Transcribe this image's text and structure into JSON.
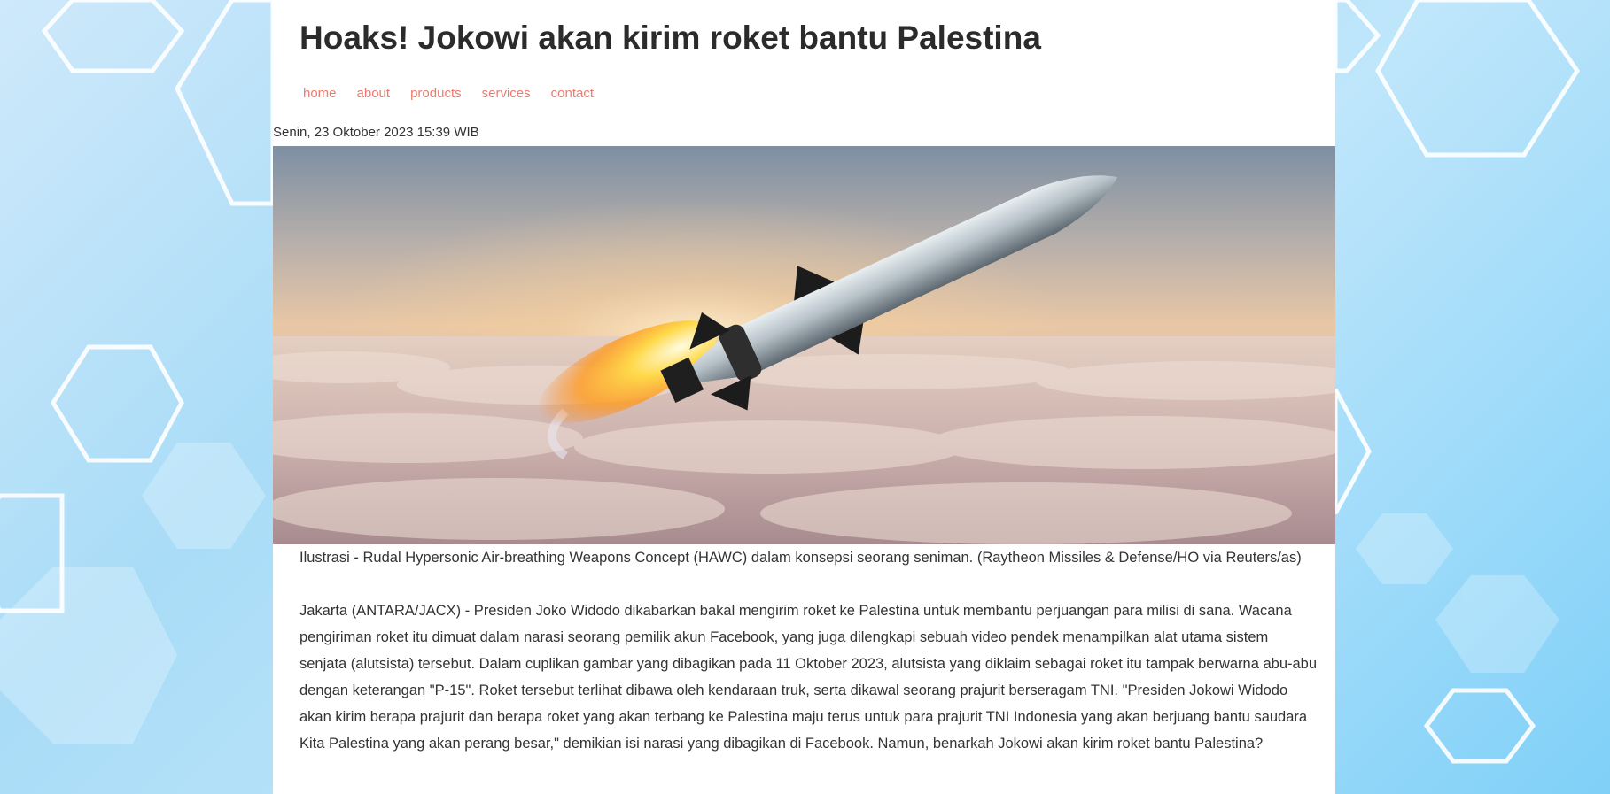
{
  "article": {
    "title": "Hoaks! Jokowi akan kirim roket bantu Palestina",
    "date": "Senin, 23 Oktober 2023 15:39 WIB",
    "image_caption": "Ilustrasi - Rudal Hypersonic Air-breathing Weapons Concept (HAWC) dalam konsepsi seorang seniman. (Raytheon Missiles & Defense/HO via Reuters/as)",
    "body": "Jakarta (ANTARA/JACX) - Presiden Joko Widodo dikabarkan bakal mengirim roket ke Palestina untuk membantu perjuangan para milisi di sana. Wacana pengiriman roket itu dimuat dalam narasi seorang pemilik akun Facebook, yang juga dilengkapi sebuah video pendek menampilkan alat utama sistem senjata (alutsista) tersebut. Dalam cuplikan gambar yang dibagikan pada 11 Oktober 2023, alutsista yang diklaim sebagai roket itu tampak berwarna abu-abu dengan keterangan \"P-15\". Roket tersebut terlihat dibawa oleh kendaraan truk, serta dikawal seorang prajurit berseragam TNI. \"Presiden Jokowi Widodo akan kirim berapa prajurit dan berapa roket yang akan terbang ke Palestina maju terus untuk para prajurit TNI Indonesia yang akan berjuang bantu saudara Kita Palestina yang akan perang besar,\" demikian isi narasi yang dibagikan di Facebook. Namun, benarkah Jokowi akan kirim roket bantu Palestina?"
  },
  "nav": {
    "home": "home",
    "about": "about",
    "products": "products",
    "services": "services",
    "contact": "contact"
  },
  "colors": {
    "nav_link": "#f07b6c",
    "background": "#a9dcf7"
  }
}
